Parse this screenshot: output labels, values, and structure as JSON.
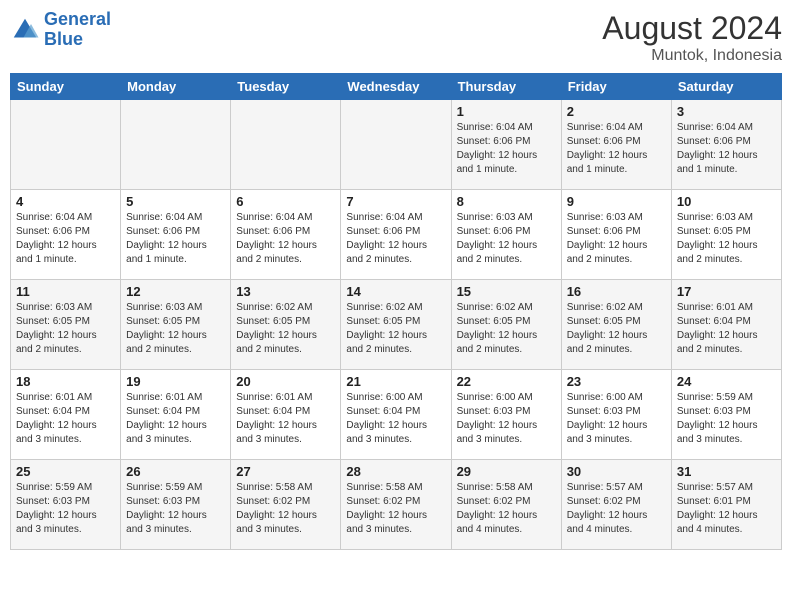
{
  "header": {
    "logo_line1": "General",
    "logo_line2": "Blue",
    "month_year": "August 2024",
    "location": "Muntok, Indonesia"
  },
  "days_of_week": [
    "Sunday",
    "Monday",
    "Tuesday",
    "Wednesday",
    "Thursday",
    "Friday",
    "Saturday"
  ],
  "weeks": [
    [
      {
        "day": "",
        "info": ""
      },
      {
        "day": "",
        "info": ""
      },
      {
        "day": "",
        "info": ""
      },
      {
        "day": "",
        "info": ""
      },
      {
        "day": "1",
        "info": "Sunrise: 6:04 AM\nSunset: 6:06 PM\nDaylight: 12 hours\nand 1 minute."
      },
      {
        "day": "2",
        "info": "Sunrise: 6:04 AM\nSunset: 6:06 PM\nDaylight: 12 hours\nand 1 minute."
      },
      {
        "day": "3",
        "info": "Sunrise: 6:04 AM\nSunset: 6:06 PM\nDaylight: 12 hours\nand 1 minute."
      }
    ],
    [
      {
        "day": "4",
        "info": "Sunrise: 6:04 AM\nSunset: 6:06 PM\nDaylight: 12 hours\nand 1 minute."
      },
      {
        "day": "5",
        "info": "Sunrise: 6:04 AM\nSunset: 6:06 PM\nDaylight: 12 hours\nand 1 minute."
      },
      {
        "day": "6",
        "info": "Sunrise: 6:04 AM\nSunset: 6:06 PM\nDaylight: 12 hours\nand 2 minutes."
      },
      {
        "day": "7",
        "info": "Sunrise: 6:04 AM\nSunset: 6:06 PM\nDaylight: 12 hours\nand 2 minutes."
      },
      {
        "day": "8",
        "info": "Sunrise: 6:03 AM\nSunset: 6:06 PM\nDaylight: 12 hours\nand 2 minutes."
      },
      {
        "day": "9",
        "info": "Sunrise: 6:03 AM\nSunset: 6:06 PM\nDaylight: 12 hours\nand 2 minutes."
      },
      {
        "day": "10",
        "info": "Sunrise: 6:03 AM\nSunset: 6:05 PM\nDaylight: 12 hours\nand 2 minutes."
      }
    ],
    [
      {
        "day": "11",
        "info": "Sunrise: 6:03 AM\nSunset: 6:05 PM\nDaylight: 12 hours\nand 2 minutes."
      },
      {
        "day": "12",
        "info": "Sunrise: 6:03 AM\nSunset: 6:05 PM\nDaylight: 12 hours\nand 2 minutes."
      },
      {
        "day": "13",
        "info": "Sunrise: 6:02 AM\nSunset: 6:05 PM\nDaylight: 12 hours\nand 2 minutes."
      },
      {
        "day": "14",
        "info": "Sunrise: 6:02 AM\nSunset: 6:05 PM\nDaylight: 12 hours\nand 2 minutes."
      },
      {
        "day": "15",
        "info": "Sunrise: 6:02 AM\nSunset: 6:05 PM\nDaylight: 12 hours\nand 2 minutes."
      },
      {
        "day": "16",
        "info": "Sunrise: 6:02 AM\nSunset: 6:05 PM\nDaylight: 12 hours\nand 2 minutes."
      },
      {
        "day": "17",
        "info": "Sunrise: 6:01 AM\nSunset: 6:04 PM\nDaylight: 12 hours\nand 2 minutes."
      }
    ],
    [
      {
        "day": "18",
        "info": "Sunrise: 6:01 AM\nSunset: 6:04 PM\nDaylight: 12 hours\nand 3 minutes."
      },
      {
        "day": "19",
        "info": "Sunrise: 6:01 AM\nSunset: 6:04 PM\nDaylight: 12 hours\nand 3 minutes."
      },
      {
        "day": "20",
        "info": "Sunrise: 6:01 AM\nSunset: 6:04 PM\nDaylight: 12 hours\nand 3 minutes."
      },
      {
        "day": "21",
        "info": "Sunrise: 6:00 AM\nSunset: 6:04 PM\nDaylight: 12 hours\nand 3 minutes."
      },
      {
        "day": "22",
        "info": "Sunrise: 6:00 AM\nSunset: 6:03 PM\nDaylight: 12 hours\nand 3 minutes."
      },
      {
        "day": "23",
        "info": "Sunrise: 6:00 AM\nSunset: 6:03 PM\nDaylight: 12 hours\nand 3 minutes."
      },
      {
        "day": "24",
        "info": "Sunrise: 5:59 AM\nSunset: 6:03 PM\nDaylight: 12 hours\nand 3 minutes."
      }
    ],
    [
      {
        "day": "25",
        "info": "Sunrise: 5:59 AM\nSunset: 6:03 PM\nDaylight: 12 hours\nand 3 minutes."
      },
      {
        "day": "26",
        "info": "Sunrise: 5:59 AM\nSunset: 6:03 PM\nDaylight: 12 hours\nand 3 minutes."
      },
      {
        "day": "27",
        "info": "Sunrise: 5:58 AM\nSunset: 6:02 PM\nDaylight: 12 hours\nand 3 minutes."
      },
      {
        "day": "28",
        "info": "Sunrise: 5:58 AM\nSunset: 6:02 PM\nDaylight: 12 hours\nand 3 minutes."
      },
      {
        "day": "29",
        "info": "Sunrise: 5:58 AM\nSunset: 6:02 PM\nDaylight: 12 hours\nand 4 minutes."
      },
      {
        "day": "30",
        "info": "Sunrise: 5:57 AM\nSunset: 6:02 PM\nDaylight: 12 hours\nand 4 minutes."
      },
      {
        "day": "31",
        "info": "Sunrise: 5:57 AM\nSunset: 6:01 PM\nDaylight: 12 hours\nand 4 minutes."
      }
    ]
  ]
}
